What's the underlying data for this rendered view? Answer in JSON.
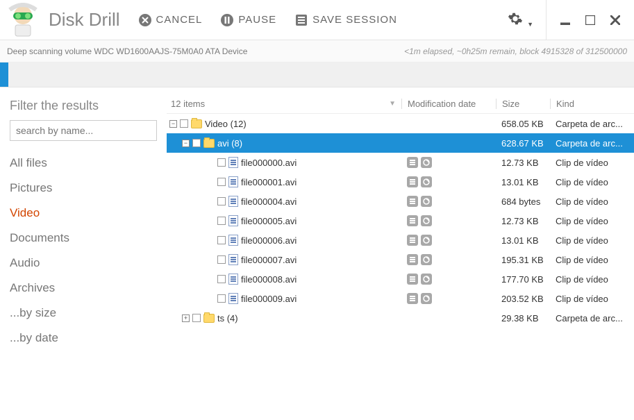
{
  "app": {
    "title": "Disk Drill"
  },
  "toolbar": {
    "cancel": "CANCEL",
    "pause": "PAUSE",
    "save": "SAVE SESSION"
  },
  "status": {
    "left": "Deep scanning volume WDC WD1600AAJS-75M0A0 ATA Device",
    "right": "<1m elapsed, ~0h25m remain, block 4915328 of 312500000"
  },
  "sidebar": {
    "title": "Filter the results",
    "search_placeholder": "search by name...",
    "filters": {
      "all": "All files",
      "pictures": "Pictures",
      "video": "Video",
      "documents": "Documents",
      "audio": "Audio",
      "archives": "Archives",
      "bysize": "...by size",
      "bydate": "...by date"
    }
  },
  "columns": {
    "items": "12 items",
    "mod": "Modification date",
    "size": "Size",
    "kind": "Kind"
  },
  "rows": [
    {
      "indent": 0,
      "expander": "−",
      "type": "folder",
      "name": "Video  (12)",
      "size": "658.05 KB",
      "kind": "Carpeta de arc...",
      "selected": false
    },
    {
      "indent": 1,
      "expander": "−",
      "type": "folder",
      "name": "avi (8)",
      "size": "628.67 KB",
      "kind": "Carpeta de arc...",
      "selected": true
    },
    {
      "indent": 2,
      "expander": "",
      "type": "file",
      "name": "file000000.avi",
      "size": "12.73 KB",
      "kind": "Clip de vídeo",
      "actions": true
    },
    {
      "indent": 2,
      "expander": "",
      "type": "file",
      "name": "file000001.avi",
      "size": "13.01 KB",
      "kind": "Clip de vídeo",
      "actions": true
    },
    {
      "indent": 2,
      "expander": "",
      "type": "file",
      "name": "file000004.avi",
      "size": "684 bytes",
      "kind": "Clip de vídeo",
      "actions": true
    },
    {
      "indent": 2,
      "expander": "",
      "type": "file",
      "name": "file000005.avi",
      "size": "12.73 KB",
      "kind": "Clip de vídeo",
      "actions": true
    },
    {
      "indent": 2,
      "expander": "",
      "type": "file",
      "name": "file000006.avi",
      "size": "13.01 KB",
      "kind": "Clip de vídeo",
      "actions": true
    },
    {
      "indent": 2,
      "expander": "",
      "type": "file",
      "name": "file000007.avi",
      "size": "195.31 KB",
      "kind": "Clip de vídeo",
      "actions": true
    },
    {
      "indent": 2,
      "expander": "",
      "type": "file",
      "name": "file000008.avi",
      "size": "177.70 KB",
      "kind": "Clip de vídeo",
      "actions": true
    },
    {
      "indent": 2,
      "expander": "",
      "type": "file",
      "name": "file000009.avi",
      "size": "203.52 KB",
      "kind": "Clip de vídeo",
      "actions": true
    },
    {
      "indent": 1,
      "expander": "+",
      "type": "folder",
      "name": "ts  (4)",
      "size": "29.38 KB",
      "kind": "Carpeta de arc...",
      "selected": false
    }
  ]
}
